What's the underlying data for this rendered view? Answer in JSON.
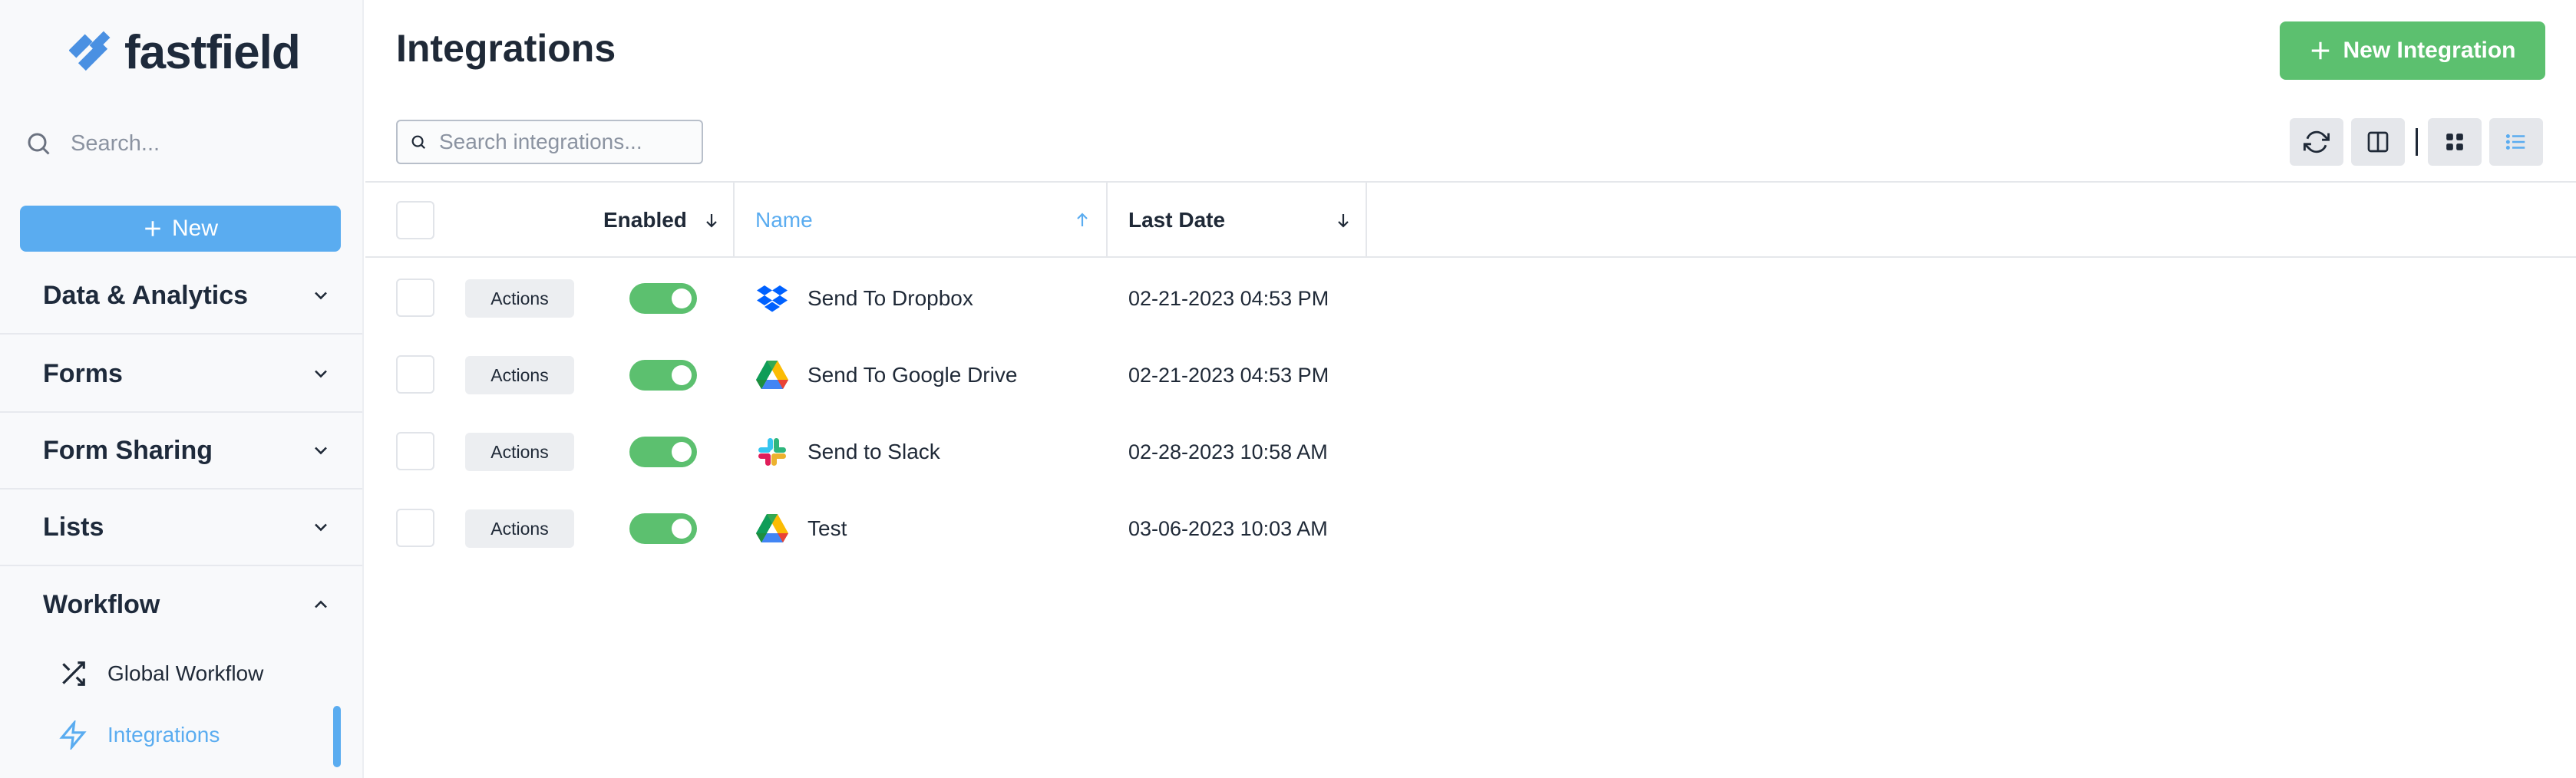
{
  "brand": {
    "name": "fastfield"
  },
  "sidebar": {
    "search_placeholder": "Search...",
    "new_label": "New",
    "sections": [
      {
        "label": "Data & Analytics",
        "expanded": false
      },
      {
        "label": "Forms",
        "expanded": false
      },
      {
        "label": "Form Sharing",
        "expanded": false
      },
      {
        "label": "Lists",
        "expanded": false
      },
      {
        "label": "Workflow",
        "expanded": true
      }
    ],
    "workflow_items": [
      {
        "label": "Global Workflow",
        "icon": "shuffle-icon",
        "active": false
      },
      {
        "label": "Integrations",
        "icon": "lightning-icon",
        "active": true
      }
    ]
  },
  "header": {
    "title": "Integrations",
    "new_integration_label": "New Integration",
    "search_placeholder": "Search integrations..."
  },
  "toolbar": {
    "buttons": [
      "refresh-icon",
      "columns-icon",
      "grid-view-icon",
      "list-view-icon"
    ]
  },
  "table": {
    "columns": {
      "enabled": "Enabled",
      "name": "Name",
      "last_date": "Last Date"
    },
    "sort": {
      "column": "name",
      "direction": "asc"
    },
    "actions_label": "Actions",
    "rows": [
      {
        "enabled": true,
        "icon": "dropbox-icon",
        "name": "Send To Dropbox",
        "last_date": "02-21-2023 04:53 PM"
      },
      {
        "enabled": true,
        "icon": "google-drive-icon",
        "name": "Send To Google Drive",
        "last_date": "02-21-2023 04:53 PM"
      },
      {
        "enabled": true,
        "icon": "slack-icon",
        "name": "Send to Slack",
        "last_date": "02-28-2023 10:58 AM"
      },
      {
        "enabled": true,
        "icon": "google-drive-icon",
        "name": "Test",
        "last_date": "03-06-2023 10:03 AM"
      }
    ]
  },
  "colors": {
    "accent": "#5aacf0",
    "success": "#5cc06f",
    "text": "#1f2937"
  }
}
